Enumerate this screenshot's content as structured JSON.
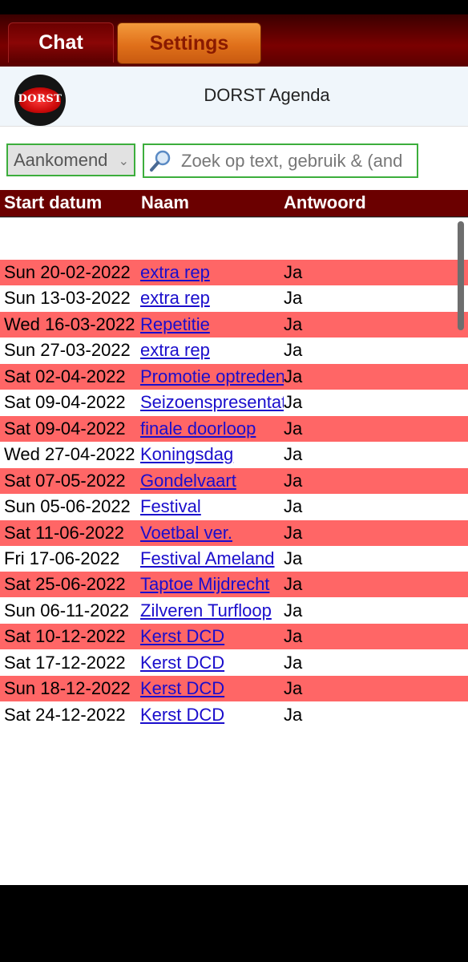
{
  "tabs": {
    "chat": "Chat",
    "settings": "Settings"
  },
  "header": {
    "title": "DORST Agenda",
    "logo_text": "DORST"
  },
  "filter": {
    "selected": "Aankomend"
  },
  "search": {
    "placeholder": "Zoek op text, gebruik & (and"
  },
  "table": {
    "headers": [
      "Start datum",
      "Naam",
      "Antwoord"
    ],
    "rows": [
      {
        "date": "Sun 20-02-2022",
        "name": "extra rep",
        "answer": "Ja"
      },
      {
        "date": "Sun 13-03-2022",
        "name": "extra rep",
        "answer": "Ja"
      },
      {
        "date": "Wed 16-03-2022",
        "name": "Repetitie",
        "answer": "Ja"
      },
      {
        "date": "Sun 27-03-2022",
        "name": "extra rep",
        "answer": "Ja"
      },
      {
        "date": "Sat 02-04-2022",
        "name": "Promotie optreden",
        "answer": "Ja"
      },
      {
        "date": "Sat 09-04-2022",
        "name": "Seizoenspresentatie",
        "answer": "Ja"
      },
      {
        "date": "Sat 09-04-2022",
        "name": "finale doorloop",
        "answer": "Ja"
      },
      {
        "date": "Wed 27-04-2022",
        "name": "Koningsdag",
        "answer": "Ja"
      },
      {
        "date": "Sat 07-05-2022",
        "name": "Gondelvaart",
        "answer": "Ja"
      },
      {
        "date": "Sun 05-06-2022",
        "name": "Festival",
        "answer": "Ja"
      },
      {
        "date": "Sat 11-06-2022",
        "name": "Voetbal ver.",
        "answer": "Ja"
      },
      {
        "date": "Fri 17-06-2022",
        "name": "Festival Ameland",
        "answer": "Ja"
      },
      {
        "date": "Sat 25-06-2022",
        "name": "Taptoe Mijdrecht",
        "answer": "Ja"
      },
      {
        "date": "Sun 06-11-2022",
        "name": "Zilveren Turfloop",
        "answer": "Ja"
      },
      {
        "date": "Sat 10-12-2022",
        "name": "Kerst DCD",
        "answer": "Ja"
      },
      {
        "date": "Sat 17-12-2022",
        "name": "Kerst DCD",
        "answer": "Ja"
      },
      {
        "date": "Sun 18-12-2022",
        "name": "Kerst DCD",
        "answer": "Ja"
      },
      {
        "date": "Sat 24-12-2022",
        "name": "Kerst DCD",
        "answer": "Ja"
      }
    ]
  },
  "colors": {
    "tabbar": "#6b0000",
    "settings_tab": "#e0701a",
    "row_highlight": "#ff6666",
    "link": "#1a0dcc",
    "input_border": "#3cae3c"
  },
  "icons": {
    "search": "magnifier-icon",
    "select": "chevron-down-icon"
  }
}
